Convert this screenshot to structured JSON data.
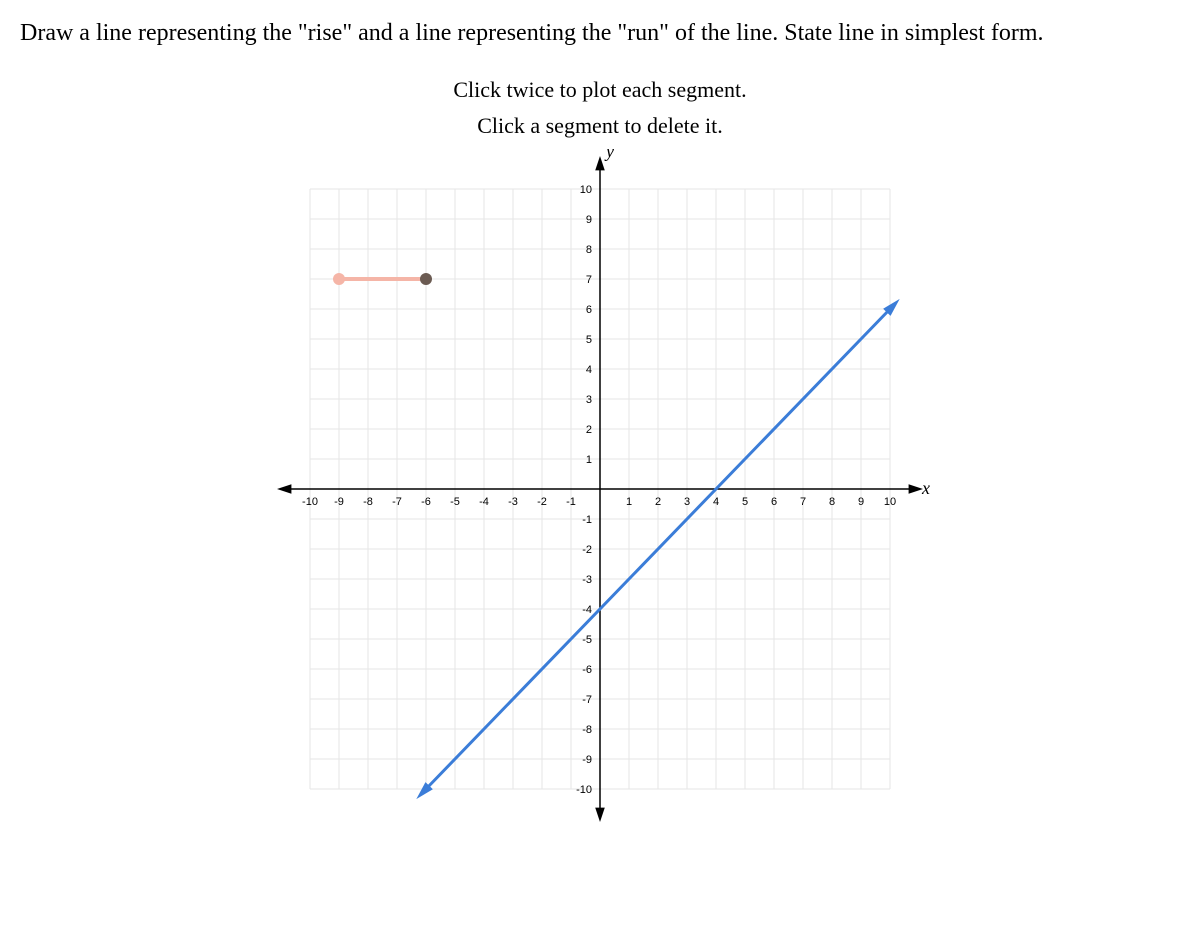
{
  "question": "Draw a line representing the \"rise\" and a line representing the \"run\" of the line. State line in simplest form.",
  "hintLine1": "Click twice to plot each segment.",
  "hintLine2": "Click a segment to delete it.",
  "chart_data": {
    "type": "line",
    "xlabel": "x",
    "ylabel": "y",
    "xlim": [
      -10,
      10
    ],
    "ylim": [
      -10,
      10
    ],
    "xticks": [
      -10,
      -9,
      -8,
      -7,
      -6,
      -5,
      -4,
      -3,
      -2,
      -1,
      1,
      2,
      3,
      4,
      5,
      6,
      7,
      8,
      9,
      10
    ],
    "yticks": [
      -10,
      -9,
      -8,
      -7,
      -6,
      -5,
      -4,
      -3,
      -2,
      -1,
      1,
      2,
      3,
      4,
      5,
      6,
      7,
      8,
      9,
      10
    ],
    "mainLine": {
      "slope": 1,
      "intercept": -4,
      "p1": {
        "x": -6,
        "y": -10
      },
      "p2": {
        "x": 10,
        "y": 6
      }
    },
    "userSegment": {
      "p1": {
        "x": -9,
        "y": 7
      },
      "p2": {
        "x": -6,
        "y": 7
      }
    }
  }
}
